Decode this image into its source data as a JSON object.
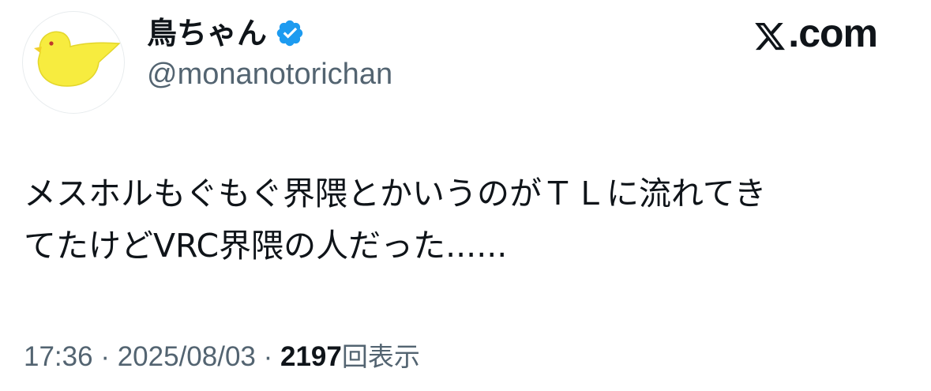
{
  "author": {
    "display_name": "鳥ちゃん",
    "handle": "@monanotorichan",
    "verified": true,
    "avatar_icon": "yellow-bird-icon"
  },
  "brand": {
    "logo_text": ".com",
    "logo_icon": "x-logo-icon"
  },
  "tweet": {
    "text": "メスホルもぐもぐ界隈とかいうのがＴＬに流れてき\nてたけどVRC界隈の人だった......"
  },
  "meta": {
    "time": "17:36",
    "separator1": " · ",
    "date": "2025/08/03",
    "separator2": " · ",
    "views_count": "2197",
    "views_label": "回表示"
  },
  "colors": {
    "text_primary": "#0f1419",
    "text_secondary": "#536471",
    "verified_blue": "#1d9bf0",
    "bird_yellow": "#f7ec3f"
  }
}
